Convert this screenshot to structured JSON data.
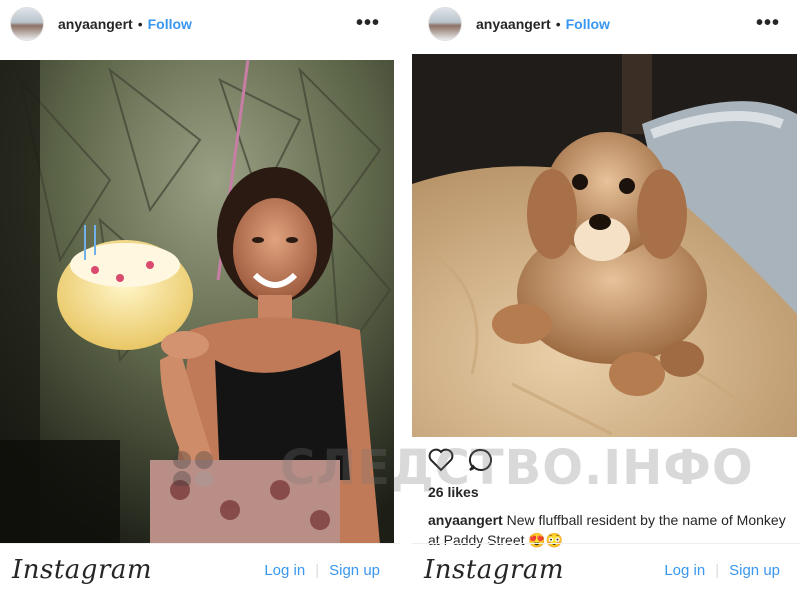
{
  "left_post": {
    "username": "anyaangert",
    "separator": "•",
    "follow_label": "Follow",
    "more_label": "•••",
    "photo_icon": "birthday-cake-photo",
    "footer": {
      "logo": "Instagram",
      "login_label": "Log in",
      "signup_label": "Sign up"
    }
  },
  "right_post": {
    "username": "anyaangert",
    "separator": "•",
    "follow_label": "Follow",
    "more_label": "•••",
    "photo_icon": "puppy-photo",
    "likes": "26 likes",
    "caption_user": "anyaangert",
    "caption_text": " New fluffball resident by the name of Monkey at Paddy Street 😍😳",
    "footer": {
      "logo": "Instagram",
      "login_label": "Log in",
      "signup_label": "Sign up"
    }
  },
  "watermark": {
    "text": "СЛЕДСТВО.ІНФО"
  },
  "colors": {
    "link": "#3897f0",
    "text": "#262626",
    "border": "#efefef"
  }
}
